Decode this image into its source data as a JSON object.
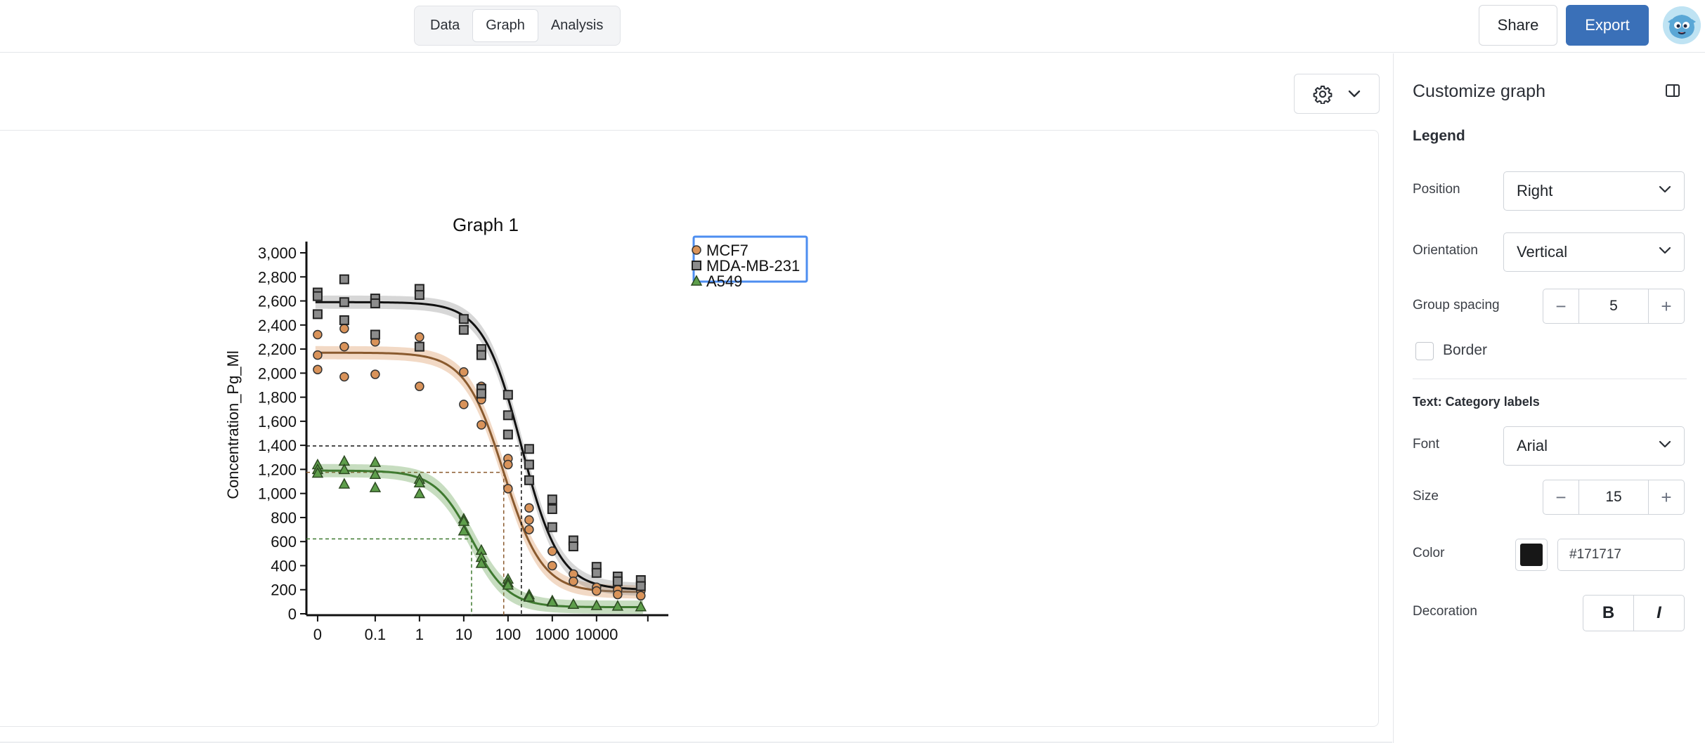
{
  "tabs": [
    {
      "label": "Data",
      "active": false
    },
    {
      "label": "Graph",
      "active": true
    },
    {
      "label": "Analysis",
      "active": false
    }
  ],
  "header": {
    "share_label": "Share",
    "export_label": "Export"
  },
  "toolbar": {
    "settings_icon": "gear-icon",
    "dropdown_icon": "chevron-down-icon"
  },
  "sidebar": {
    "title": "Customize graph",
    "legend_section": "Legend",
    "position_label": "Position",
    "position_value": "Right",
    "orientation_label": "Orientation",
    "orientation_value": "Vertical",
    "group_spacing_label": "Group spacing",
    "group_spacing_value": "5",
    "border_label": "Border",
    "border_checked": false,
    "text_section": "Text: Category labels",
    "font_label": "Font",
    "font_value": "Arial",
    "size_label": "Size",
    "size_value": "15",
    "color_label": "Color",
    "color_value": "#171717",
    "decoration_label": "Decoration",
    "bold_label": "B",
    "italic_label": "I"
  },
  "chart_data": {
    "type": "scatter",
    "title": "Graph 1",
    "xlabel": "",
    "ylabel": "Concentration_Pg_Ml",
    "x_scale": "log",
    "x_tick_labels": [
      "0",
      "0.1",
      "1",
      "10",
      "100",
      "1000",
      "10000"
    ],
    "ylim": [
      0,
      3000
    ],
    "y_ticks": [
      0,
      200,
      400,
      600,
      800,
      1000,
      1200,
      1400,
      1600,
      1800,
      2000,
      2200,
      2400,
      2600,
      2800,
      3000
    ],
    "y_tick_labels": [
      "0",
      "200",
      "400",
      "600",
      "800",
      "1,000",
      "1,200",
      "1,400",
      "1,600",
      "1,800",
      "2,000",
      "2,200",
      "2,400",
      "2,600",
      "2,800",
      "3,000"
    ],
    "grid": false,
    "legend_position": "top-right",
    "series": [
      {
        "name": "MCF7",
        "marker": "circle",
        "color": "#d9935a",
        "line_color": "#8a5a2e",
        "fit": {
          "top": 2170,
          "bottom": 180,
          "ec50": 80,
          "hill": 1.0,
          "half_value": 1175
        },
        "points": [
          [
            0.005,
            2320
          ],
          [
            0.005,
            2150
          ],
          [
            0.005,
            2030
          ],
          [
            0.02,
            2370
          ],
          [
            0.02,
            2220
          ],
          [
            0.02,
            1970
          ],
          [
            0.1,
            2260
          ],
          [
            0.1,
            1990
          ],
          [
            1,
            2300
          ],
          [
            1,
            1890
          ],
          [
            10,
            2010
          ],
          [
            10,
            1740
          ],
          [
            25,
            1890
          ],
          [
            25,
            1780
          ],
          [
            25,
            1570
          ],
          [
            100,
            1290
          ],
          [
            100,
            1240
          ],
          [
            100,
            1040
          ],
          [
            300,
            880
          ],
          [
            300,
            780
          ],
          [
            300,
            700
          ],
          [
            1000,
            520
          ],
          [
            1000,
            400
          ],
          [
            3000,
            330
          ],
          [
            3000,
            270
          ],
          [
            10000,
            220
          ],
          [
            10000,
            190
          ],
          [
            30000,
            200
          ],
          [
            30000,
            160
          ],
          [
            100000,
            190
          ],
          [
            100000,
            150
          ]
        ]
      },
      {
        "name": "MDA-MB-231",
        "marker": "square",
        "color": "#8c8c8c",
        "line_color": "#111111",
        "fit": {
          "top": 2590,
          "bottom": 200,
          "ec50": 200,
          "hill": 1.0,
          "half_value": 1395
        },
        "points": [
          [
            0.005,
            2670
          ],
          [
            0.005,
            2640
          ],
          [
            0.005,
            2490
          ],
          [
            0.02,
            2780
          ],
          [
            0.02,
            2590
          ],
          [
            0.02,
            2440
          ],
          [
            0.1,
            2620
          ],
          [
            0.1,
            2580
          ],
          [
            0.1,
            2320
          ],
          [
            1,
            2700
          ],
          [
            1,
            2650
          ],
          [
            1,
            2220
          ],
          [
            10,
            2450
          ],
          [
            10,
            2360
          ],
          [
            25,
            2200
          ],
          [
            25,
            2150
          ],
          [
            25,
            1870
          ],
          [
            25,
            1830
          ],
          [
            100,
            1820
          ],
          [
            100,
            1650
          ],
          [
            100,
            1490
          ],
          [
            300,
            1370
          ],
          [
            300,
            1240
          ],
          [
            300,
            1110
          ],
          [
            1000,
            950
          ],
          [
            1000,
            870
          ],
          [
            1000,
            720
          ],
          [
            3000,
            610
          ],
          [
            3000,
            560
          ],
          [
            10000,
            390
          ],
          [
            10000,
            340
          ],
          [
            30000,
            310
          ],
          [
            30000,
            270
          ],
          [
            100000,
            280
          ],
          [
            100000,
            230
          ]
        ]
      },
      {
        "name": "A549",
        "marker": "triangle",
        "color": "#5e9e4b",
        "line_color": "#3f7a30",
        "fit": {
          "top": 1190,
          "bottom": 55,
          "ec50": 15,
          "hill": 1.05,
          "half_value": 622
        },
        "points": [
          [
            0.005,
            1240
          ],
          [
            0.005,
            1200
          ],
          [
            0.005,
            1170
          ],
          [
            0.02,
            1270
          ],
          [
            0.02,
            1200
          ],
          [
            0.02,
            1080
          ],
          [
            0.1,
            1260
          ],
          [
            0.1,
            1160
          ],
          [
            0.1,
            1050
          ],
          [
            1,
            1120
          ],
          [
            1,
            1090
          ],
          [
            1,
            1000
          ],
          [
            10,
            790
          ],
          [
            10,
            770
          ],
          [
            10,
            690
          ],
          [
            25,
            530
          ],
          [
            25,
            470
          ],
          [
            25,
            420
          ],
          [
            100,
            290
          ],
          [
            100,
            260
          ],
          [
            100,
            240
          ],
          [
            300,
            160
          ],
          [
            300,
            140
          ],
          [
            1000,
            110
          ],
          [
            1000,
            100
          ],
          [
            3000,
            80
          ],
          [
            10000,
            70
          ],
          [
            30000,
            65
          ],
          [
            100000,
            60
          ]
        ]
      }
    ]
  }
}
